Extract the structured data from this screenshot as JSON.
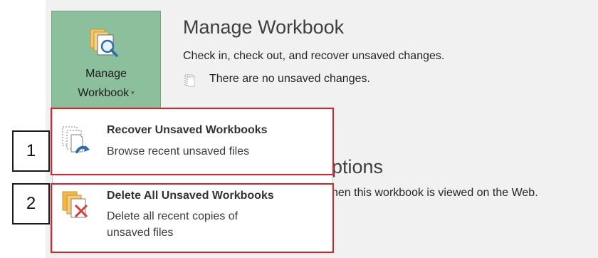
{
  "manage_button": {
    "line1": "Manage",
    "line2": "Workbook",
    "caret": "▾"
  },
  "section": {
    "title": "Manage Workbook",
    "description": "Check in, check out, and recover unsaved changes.",
    "status": "There are no unsaved changes."
  },
  "partial": {
    "options_title_fragment": "ptions",
    "options_desc_fragment": "hen this workbook is viewed on the Web."
  },
  "dropdown": {
    "items": [
      {
        "title": "Recover Unsaved Workbooks",
        "sub": "Browse recent unsaved files",
        "icon": "recover-file-icon"
      },
      {
        "title": "Delete All Unsaved Workbooks",
        "sub_line1": "Delete all recent copies of",
        "sub_line2": "unsaved files",
        "icon": "delete-file-icon"
      }
    ]
  },
  "callouts": [
    "1",
    "2"
  ],
  "colors": {
    "manage_button_bg": "#8cbf9b",
    "highlight_border": "#e0202b",
    "backstage_bg": "#f1f1f1"
  }
}
